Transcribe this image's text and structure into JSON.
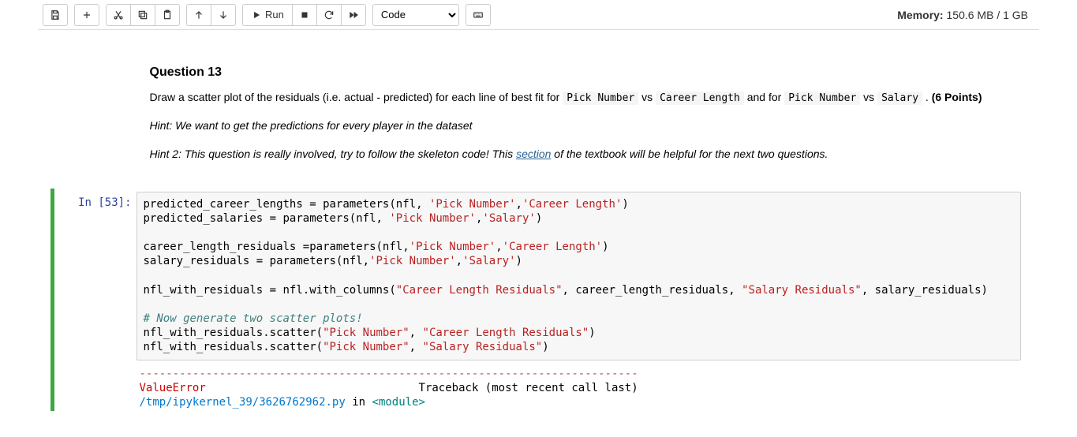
{
  "toolbar": {
    "run_label": "Run",
    "celltype": "Code"
  },
  "memory": {
    "label": "Memory:",
    "value": "150.6 MB / 1 GB"
  },
  "markdown": {
    "title": "Question 13",
    "text_before_code1": "Draw a scatter plot of the residuals (i.e. actual - predicted) for each line of best fit for ",
    "code1": "Pick Number",
    "text_mid1": " vs ",
    "code2": "Career Length",
    "text_mid2": "  and for ",
    "code3": "Pick Number",
    "text_mid3": " vs ",
    "code4": "Salary",
    "text_after": " . ",
    "points": "(6 Points)",
    "hint1": "Hint: We want to get the predictions for every player in the dataset",
    "hint2_before": "Hint 2: This question is really involved, try to follow the skeleton code! This ",
    "hint2_link": "section",
    "hint2_after": " of the textbook will be helpful for the next two questions."
  },
  "code_cell": {
    "prompt": "In [53]:",
    "lines": [
      [
        [
          "n",
          "predicted_career_lengths = parameters(nfl, "
        ],
        [
          "s",
          "'Pick Number'"
        ],
        [
          "n",
          ","
        ],
        [
          "s",
          "'Career Length'"
        ],
        [
          "n",
          ")"
        ]
      ],
      [
        [
          "n",
          "predicted_salaries = parameters(nfl, "
        ],
        [
          "s",
          "'Pick Number'"
        ],
        [
          "n",
          ","
        ],
        [
          "s",
          "'Salary'"
        ],
        [
          "n",
          ")"
        ]
      ],
      [],
      [
        [
          "n",
          "career_length_residuals =parameters(nfl,"
        ],
        [
          "s",
          "'Pick Number'"
        ],
        [
          "n",
          ","
        ],
        [
          "s",
          "'Career Length'"
        ],
        [
          "n",
          ")"
        ]
      ],
      [
        [
          "n",
          "salary_residuals = parameters(nfl,"
        ],
        [
          "s",
          "'Pick Number'"
        ],
        [
          "n",
          ","
        ],
        [
          "s",
          "'Salary'"
        ],
        [
          "n",
          ")"
        ]
      ],
      [],
      [
        [
          "n",
          "nfl_with_residuals = nfl.with_columns("
        ],
        [
          "s",
          "\"Career Length Residuals\""
        ],
        [
          "n",
          ", career_length_residuals, "
        ],
        [
          "s",
          "\"Salary Residuals\""
        ],
        [
          "n",
          ", salary_residuals)"
        ]
      ],
      [],
      [
        [
          "c",
          "# Now generate two scatter plots!"
        ]
      ],
      [
        [
          "n",
          "nfl_with_residuals.scatter("
        ],
        [
          "s",
          "\"Pick Number\""
        ],
        [
          "n",
          ", "
        ],
        [
          "s",
          "\"Career Length Residuals\""
        ],
        [
          "n",
          ")"
        ]
      ],
      [
        [
          "n",
          "nfl_with_residuals.scatter("
        ],
        [
          "s",
          "\"Pick Number\""
        ],
        [
          "n",
          ", "
        ],
        [
          "s",
          "\"Salary Residuals\""
        ],
        [
          "n",
          ")"
        ]
      ]
    ]
  },
  "output": {
    "dash_line": "---------------------------------------------------------------------------",
    "error_name": "ValueError",
    "tb_label": "Traceback (most recent call last)",
    "path_before": "/tmp/ipykernel_39/3626762962.py",
    "in_text": " in ",
    "module": "<module>"
  }
}
